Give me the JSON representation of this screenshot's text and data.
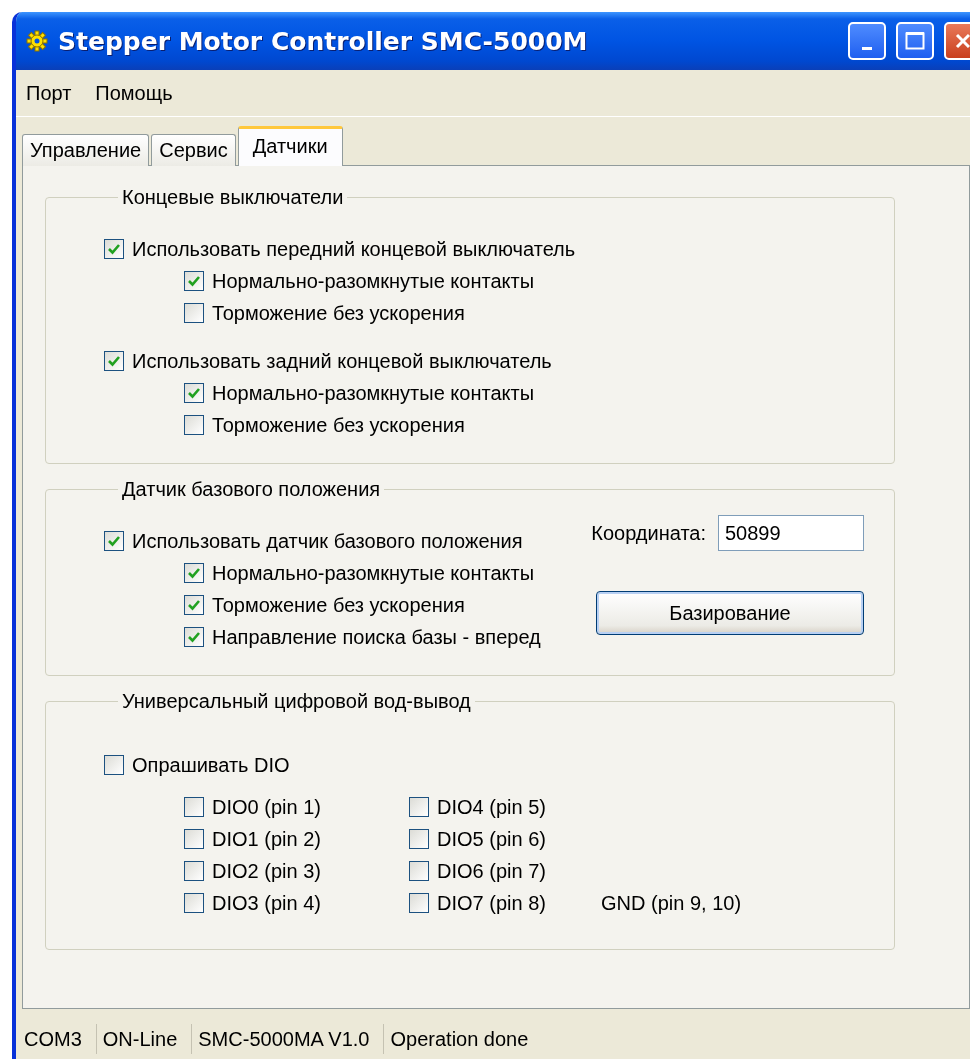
{
  "window": {
    "title": "Stepper Motor Controller SMC-5000M"
  },
  "menu": [
    {
      "label": "Порт"
    },
    {
      "label": "Помощь"
    }
  ],
  "tabs": [
    {
      "label": "Управление",
      "selected": false
    },
    {
      "label": "Сервис",
      "selected": false
    },
    {
      "label": "Датчики",
      "selected": true
    }
  ],
  "limit_switches": {
    "title": "Концевые выключатели",
    "items": [
      {
        "label": "Использовать передний концевой выключатель",
        "checked": true,
        "children": [
          {
            "label": "Нормально-разомкнутые контакты",
            "checked": true
          },
          {
            "label": "Торможение без ускорения",
            "checked": false
          }
        ]
      },
      {
        "label": "Использовать задний концевой выключатель",
        "checked": true,
        "children": [
          {
            "label": "Нормально-разомкнутые контакты",
            "checked": true
          },
          {
            "label": "Торможение без ускорения",
            "checked": false
          }
        ]
      }
    ]
  },
  "home_sensor": {
    "title": "Датчик базового положения",
    "item": {
      "label": "Использовать датчик базового положения",
      "checked": true,
      "children": [
        {
          "label": "Нормально-разомкнутые контакты",
          "checked": true
        },
        {
          "label": "Торможение без ускорения",
          "checked": true
        },
        {
          "label": "Направление поиска базы - вперед",
          "checked": true
        }
      ]
    },
    "coordinate": {
      "label": "Координата:",
      "value": "50899"
    },
    "button": "Базирование"
  },
  "dio": {
    "title": "Универсальный цифровой вод-вывод",
    "poll": {
      "label": "Опрашивать DIO",
      "checked": false
    },
    "pins": [
      {
        "label": "DIO0 (pin 1)",
        "checked": false
      },
      {
        "label": "DIO1 (pin 2)",
        "checked": false
      },
      {
        "label": "DIO2 (pin 3)",
        "checked": false
      },
      {
        "label": "DIO3 (pin 4)",
        "checked": false
      },
      {
        "label": "DIO4 (pin 5)",
        "checked": false
      },
      {
        "label": "DIO5 (pin 6)",
        "checked": false
      },
      {
        "label": "DIO6 (pin 7)",
        "checked": false
      },
      {
        "label": "DIO7 (pin 8)",
        "checked": false
      }
    ],
    "gnd": "GND (pin 9, 10)"
  },
  "status_bar": [
    "COM3",
    "ON-Line",
    "SMC-5000MA V1.0",
    "Operation done"
  ]
}
